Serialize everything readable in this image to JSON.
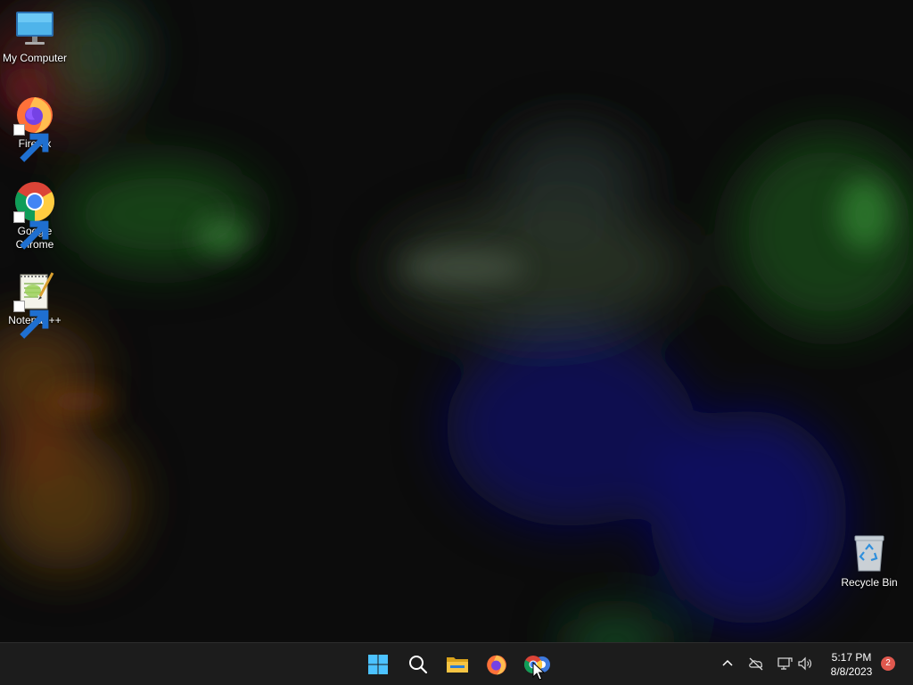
{
  "desktop": {
    "icons": [
      {
        "label": "My Computer",
        "icon": "monitor-icon",
        "shortcut": false
      },
      {
        "label": "Firefox",
        "icon": "firefox-icon",
        "shortcut": true
      },
      {
        "label": "Google Chrome",
        "icon": "chrome-icon",
        "shortcut": true
      },
      {
        "label": "Notepad++",
        "icon": "notepadpp-icon",
        "shortcut": true
      },
      {
        "label": "Recycle Bin",
        "icon": "recycle-bin-icon",
        "shortcut": false
      }
    ]
  },
  "taskbar": {
    "pinned": [
      "windows-start-icon",
      "search-icon",
      "file-explorer-icon",
      "firefox-icon",
      "chrome-icon"
    ],
    "tray": [
      "chevron-up-icon",
      "cloud-off-icon",
      "network-icon",
      "speaker-icon"
    ],
    "clock": {
      "time": "5:17 PM",
      "date": "8/8/2023"
    },
    "notification_count": "2"
  },
  "colors": {
    "taskbar_bg": "#1c1c1c",
    "desktop_bg": "#0c0c0c",
    "windows_blue": "#4cc2ff",
    "badge_red": "#e0584e"
  }
}
